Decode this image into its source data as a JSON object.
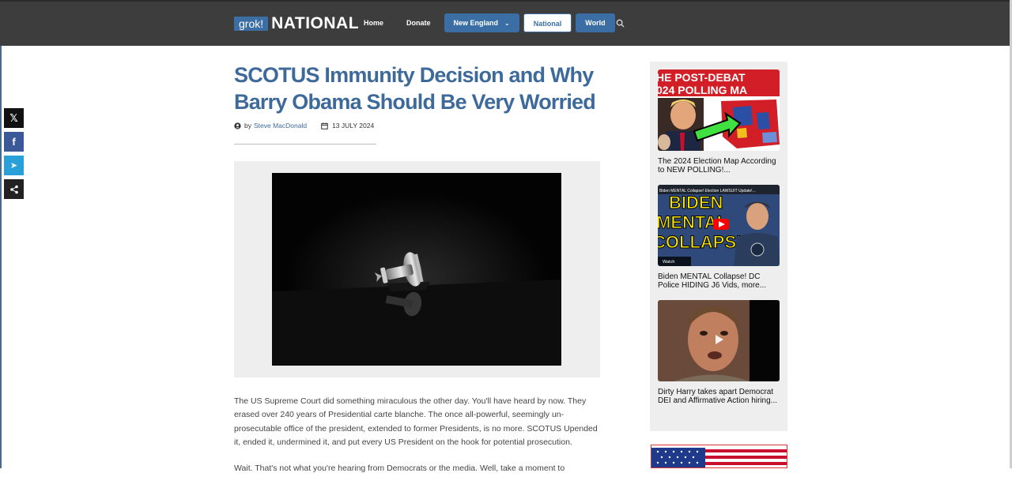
{
  "header": {
    "logo_box": "grok!",
    "logo_text": "NATIONAL",
    "nav": [
      {
        "label": "Home",
        "style": "plain"
      },
      {
        "label": "Donate",
        "style": "plain"
      },
      {
        "label": "New England",
        "style": "blue",
        "dropdown": true
      },
      {
        "label": "National",
        "style": "white"
      },
      {
        "label": "World",
        "style": "blue"
      }
    ]
  },
  "share_buttons": [
    {
      "icon": "x-icon",
      "glyph": "𝕏"
    },
    {
      "icon": "facebook-icon",
      "glyph": "f"
    },
    {
      "icon": "telegram-icon",
      "glyph": "➤"
    },
    {
      "icon": "share-icon",
      "glyph": "⋖"
    }
  ],
  "article": {
    "title": "SCOTUS Immunity Decision and Why Barry Obama Should Be Very Worried",
    "by_label": "by",
    "author": "Steve MacDonald",
    "date": "13 JULY 2024",
    "paragraphs": [
      "The US Supreme Court did something miraculous the other day. You'll have heard by now. They erased over 240 years of Presidential carte blanche. The once all-powerful, seemingly un-prosecutable office of the president, extended to former Presidents, is no more. SCOTUS Upended it, ended it, undermined it, and put every US President on the hook for potential prosecution.",
      "Wait. That's not what you're hearing from Democrats or the media. Well, take a moment to"
    ]
  },
  "sidebar": {
    "cards": [
      {
        "title": "The 2024 Election Map According to NEW POLLING!...",
        "thumb_text_1": "HE POST-DEBAT",
        "thumb_text_2": "024 POLLING MA"
      },
      {
        "title": "Biden MENTAL Collapse! DC Police HIDING J6 Vids, more...",
        "thumb_caption": "Biden MENTAL Collapse! Election LAWSUIT Update!...",
        "thumb_text_1": "BIDEN",
        "thumb_text_2": "MENTAL",
        "thumb_text_3": "COLLAPSE!",
        "watch_label": "Watch"
      },
      {
        "title": "Dirty Harry takes apart Democrat DEI and Affirmative Action hiring..."
      }
    ]
  },
  "colors": {
    "topbar": "#3d3d3d",
    "accent": "#3b6ea5",
    "title": "#3d6a9b",
    "sidebar_bg": "#eeeeee"
  }
}
